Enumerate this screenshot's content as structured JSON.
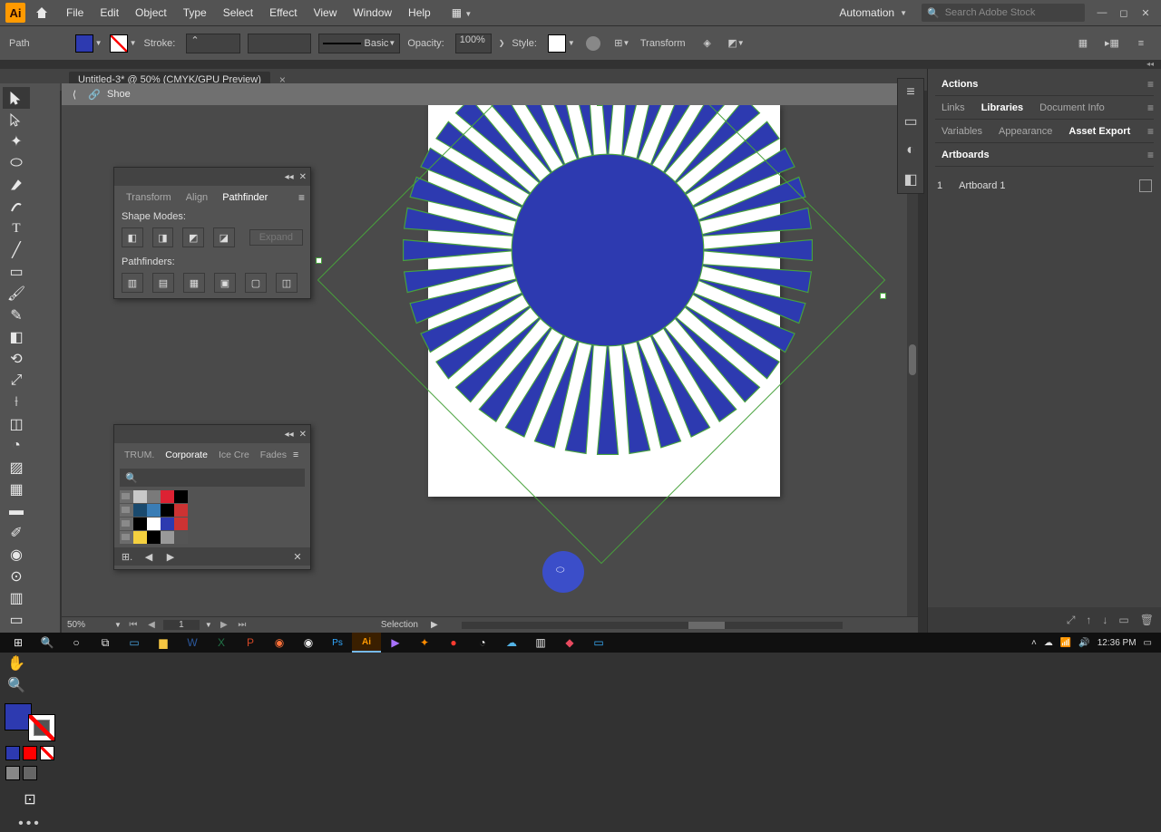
{
  "menu": {
    "items": [
      "File",
      "Edit",
      "Object",
      "Type",
      "Select",
      "Effect",
      "View",
      "Window",
      "Help"
    ],
    "workspace": "Automation",
    "search_placeholder": "Search Adobe Stock"
  },
  "control": {
    "path_label": "Path",
    "stroke_label": "Stroke:",
    "stroke_weight": "",
    "brush_style": "Basic",
    "opacity_label": "Opacity:",
    "opacity_value": "100%",
    "style_label": "Style:",
    "transform_label": "Transform"
  },
  "doc": {
    "tab_title": "Untitled-3* @ 50% (CMYK/GPU Preview)",
    "context_label": "Shoe"
  },
  "pathfinder": {
    "tabs": [
      "Transform",
      "Align",
      "Pathfinder"
    ],
    "active": 2,
    "shape_modes_label": "Shape Modes:",
    "expand": "Expand",
    "pathfinders_label": "Pathfinders:"
  },
  "swatches": {
    "tabs": [
      "TRUM.",
      "Corporate",
      "Ice Cre",
      "Fades"
    ],
    "active": 1
  },
  "rightdock": {
    "actions": "Actions",
    "row1": [
      "Links",
      "Libraries",
      "Document Info"
    ],
    "row1_active": 1,
    "row2": [
      "Variables",
      "Appearance",
      "Asset Export"
    ],
    "row2_active": 2,
    "row3": [
      "Artboards"
    ],
    "artboards": [
      {
        "num": "1",
        "name": "Artboard 1"
      }
    ]
  },
  "status": {
    "zoom": "50%",
    "artboard": "1",
    "selection": "Selection"
  },
  "tray": {
    "time": "12:36 PM"
  },
  "colors": {
    "fill": "#2d3ab0",
    "selection": "#47a23c"
  }
}
